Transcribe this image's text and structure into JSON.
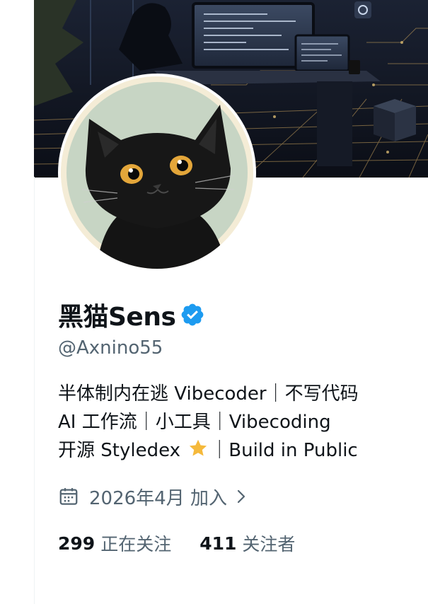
{
  "profile": {
    "display_name": "黑猫Sens",
    "handle": "@Axnino55",
    "verified_icon": "verified-badge-icon",
    "bio": {
      "line1": "半体制内在逃 Vibecoder｜不写代码",
      "line2": "AI 工作流｜小工具｜Vibecoding",
      "line3_before": "开源 Styledex ",
      "line3_after": "｜Build in Public"
    },
    "joined": "2026年4月 加入",
    "following_count": "299",
    "following_label": "正在关注",
    "followers_count": "411",
    "followers_label": "关注者"
  },
  "colors": {
    "text_primary": "#0f1419",
    "text_secondary": "#536471",
    "verified_blue": "#1d9bf0",
    "star": "#f5b93b"
  }
}
